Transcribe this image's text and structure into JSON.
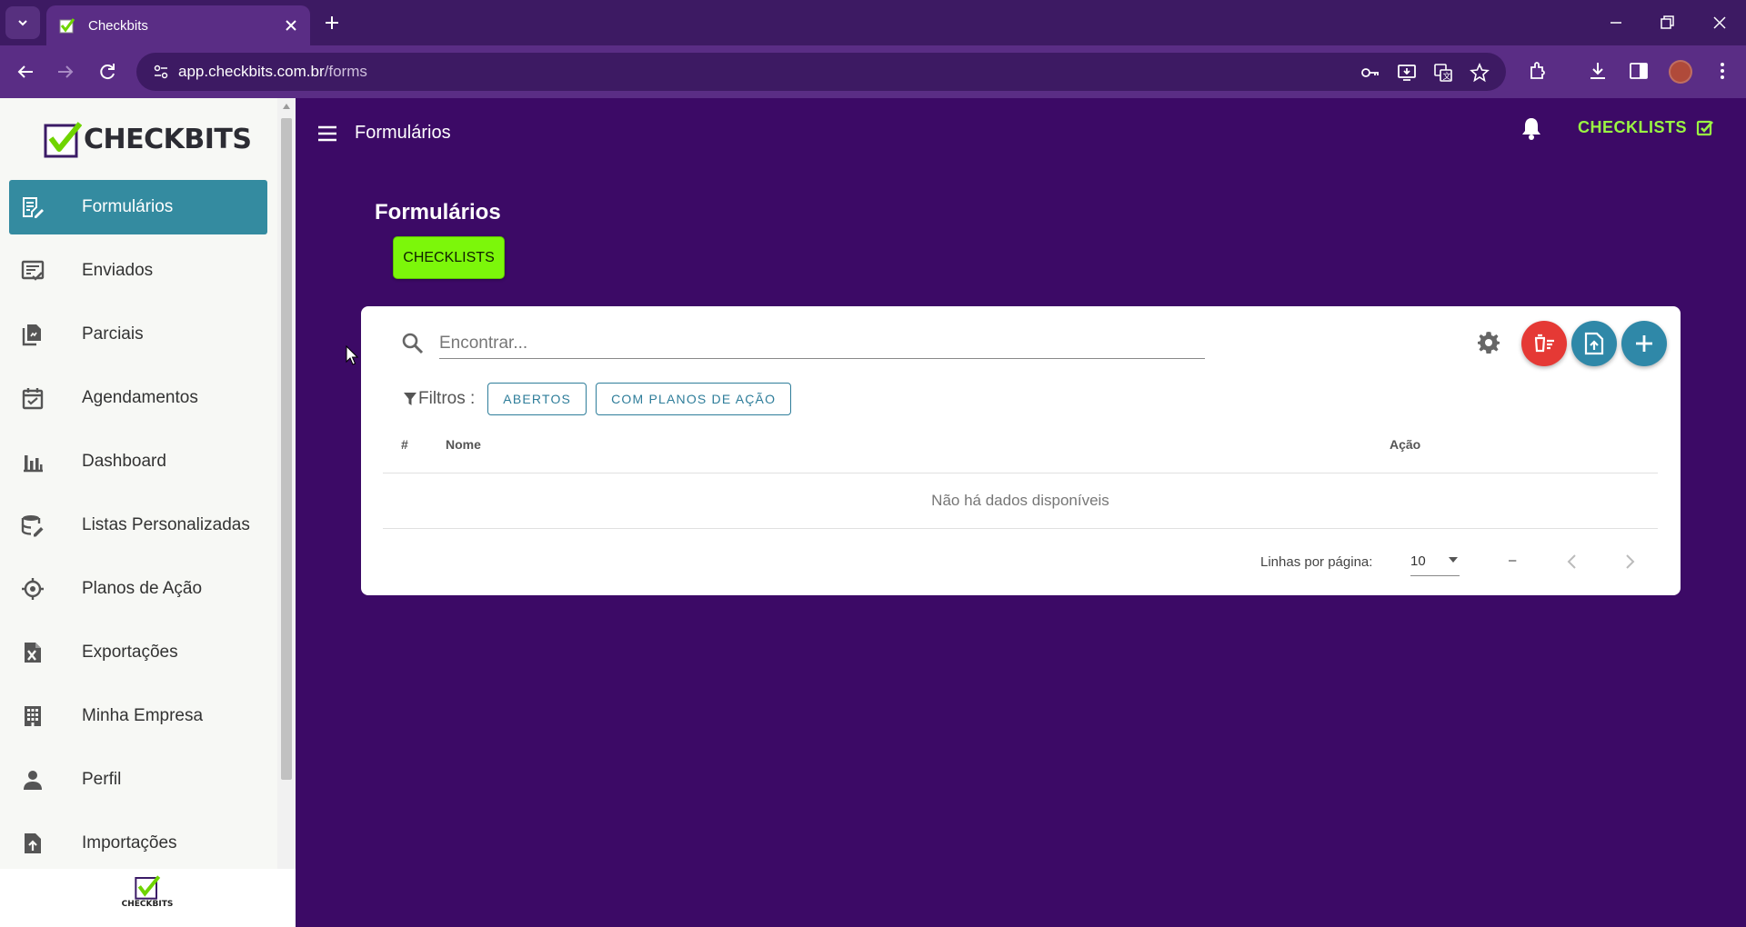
{
  "browser": {
    "tab_title": "Checkbits",
    "url_host": "app.checkbits.com.br",
    "url_path": "/forms"
  },
  "sidebar": {
    "logo_text": "CHECKBITS",
    "footer_logo_text": "CHECKBITS",
    "items": [
      {
        "label": "Formulários",
        "icon": "form-edit-icon",
        "active": true
      },
      {
        "label": "Enviados",
        "icon": "sent-list-icon",
        "active": false
      },
      {
        "label": "Parciais",
        "icon": "partial-docs-icon",
        "active": false
      },
      {
        "label": "Agendamentos",
        "icon": "calendar-check-icon",
        "active": false
      },
      {
        "label": "Dashboard",
        "icon": "bar-chart-icon",
        "active": false
      },
      {
        "label": "Listas Personalizadas",
        "icon": "database-edit-icon",
        "active": false
      },
      {
        "label": "Planos de Ação",
        "icon": "crosshair-icon",
        "active": false
      },
      {
        "label": "Exportações",
        "icon": "excel-file-icon",
        "active": false
      },
      {
        "label": "Minha Empresa",
        "icon": "building-icon",
        "active": false
      },
      {
        "label": "Perfil",
        "icon": "person-icon",
        "active": false
      },
      {
        "label": "Importações",
        "icon": "file-upload-icon",
        "active": false
      }
    ]
  },
  "header": {
    "title": "Formulários",
    "right_label": "CHECKLISTS"
  },
  "page": {
    "heading": "Formulários",
    "chip": "CHECKLISTS"
  },
  "table": {
    "search_placeholder": "Encontrar...",
    "filters_label": "Filtros :",
    "filters": [
      "ABERTOS",
      "COM PLANOS DE AÇÃO"
    ],
    "columns": [
      "#",
      "Nome",
      "Ação"
    ],
    "empty_message": "Não há dados disponíveis",
    "rows_per_page_label": "Linhas por página:",
    "rows_per_page": "10",
    "range": "–"
  },
  "colors": {
    "background": "#3c0a66",
    "sidebar_active": "#348ba0",
    "accent_green": "#7cf70a",
    "fab_red": "#e53935",
    "fab_teal": "#2f88a8"
  }
}
